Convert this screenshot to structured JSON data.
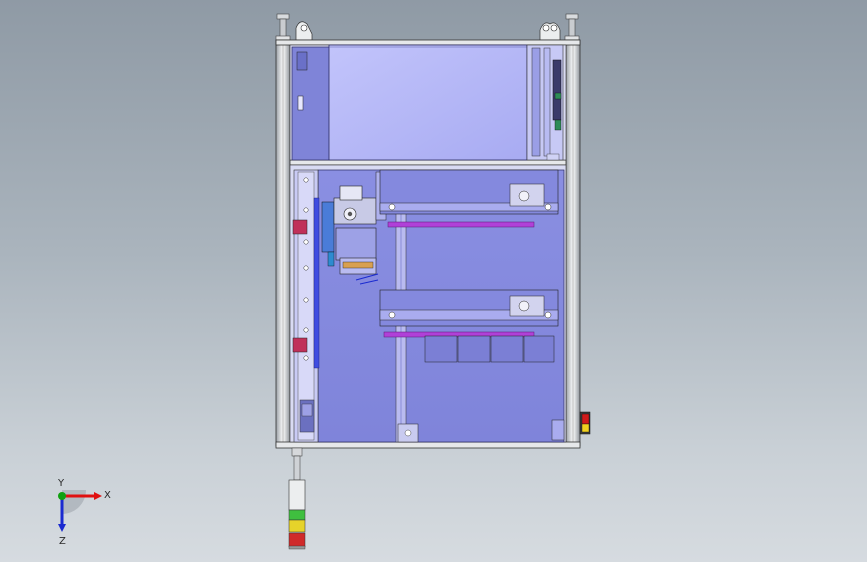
{
  "viewport": {
    "background_top": "#8f9aa5",
    "background_bottom": "#d6dbe0"
  },
  "model": {
    "frame_color": "#e6e8ea",
    "panel_blue": "#8a8fe0",
    "panel_light": "#b4b6f6",
    "rail_magenta": "#b040d8",
    "accent_red": "#c0305a"
  },
  "stack_light": {
    "colors": [
      "#3fbf3f",
      "#e6d32a",
      "#d02a2a"
    ]
  },
  "triad": {
    "x_label": "X",
    "y_label": "Y",
    "z_label": "Z",
    "x_color": "#e01010",
    "y_color": "#10a010",
    "z_color": "#1a2ad0"
  }
}
